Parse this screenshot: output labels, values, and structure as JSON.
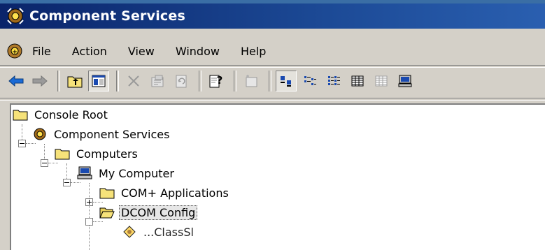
{
  "window": {
    "title": "Component Services"
  },
  "menu": {
    "items": [
      "File",
      "Action",
      "View",
      "Window",
      "Help"
    ]
  },
  "toolbar": {
    "buttons": [
      "back-arrow",
      "forward-arrow",
      "up-folder",
      "show-hide-console-tree",
      "delete",
      "properties",
      "refresh",
      "help",
      "new-window",
      "large-icons",
      "small-icons",
      "list",
      "detail",
      "detail-alt",
      "computer"
    ]
  },
  "tree": {
    "root": "Console Root",
    "component_services": "Component Services",
    "computers": "Computers",
    "my_computer": "My Computer",
    "com_apps": "COM+ Applications",
    "dcom_config": "DCOM Config",
    "partial": "...ClassSl"
  },
  "colors": {
    "title_bar": "#0a246a",
    "chrome": "#d4d0c8",
    "tree_bg": "#ffffff",
    "folder": "#f6e27a"
  }
}
